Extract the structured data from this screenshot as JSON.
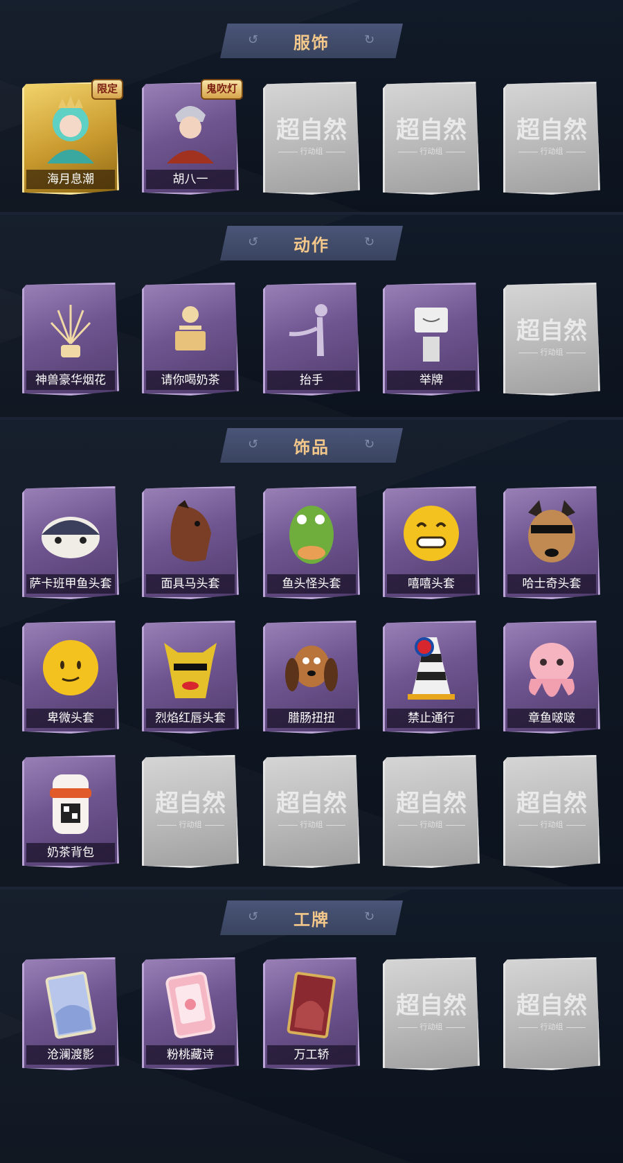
{
  "sections": [
    {
      "title": "服饰",
      "items": [
        {
          "label": "海月息潮",
          "tag": "限定"
        },
        {
          "label": "胡八一",
          "tag": "鬼吹灯"
        },
        {
          "label": ""
        },
        {
          "label": ""
        },
        {
          "label": ""
        }
      ]
    },
    {
      "title": "动作",
      "items": [
        {
          "label": "神兽豪华烟花"
        },
        {
          "label": "请你喝奶茶"
        },
        {
          "label": "抬手"
        },
        {
          "label": "举牌"
        },
        {
          "label": ""
        }
      ]
    },
    {
      "title": "饰品",
      "items": [
        {
          "label": "萨卡班甲鱼头套"
        },
        {
          "label": "面具马头套"
        },
        {
          "label": "鱼头怪头套"
        },
        {
          "label": "嘻嘻头套"
        },
        {
          "label": "哈士奇头套"
        },
        {
          "label": "卑微头套"
        },
        {
          "label": "烈焰红唇头套"
        },
        {
          "label": "腊肠扭扭"
        },
        {
          "label": "禁止通行"
        },
        {
          "label": "章鱼啵啵"
        },
        {
          "label": "奶茶背包"
        },
        {
          "label": ""
        },
        {
          "label": ""
        },
        {
          "label": ""
        },
        {
          "label": ""
        }
      ]
    },
    {
      "title": "工牌",
      "items": [
        {
          "label": "沧澜渡影"
        },
        {
          "label": "粉桃藏诗"
        },
        {
          "label": "万工轿"
        },
        {
          "label": ""
        },
        {
          "label": ""
        }
      ]
    }
  ],
  "placeholder": {
    "mark": "超自然",
    "sub": "行动组"
  }
}
